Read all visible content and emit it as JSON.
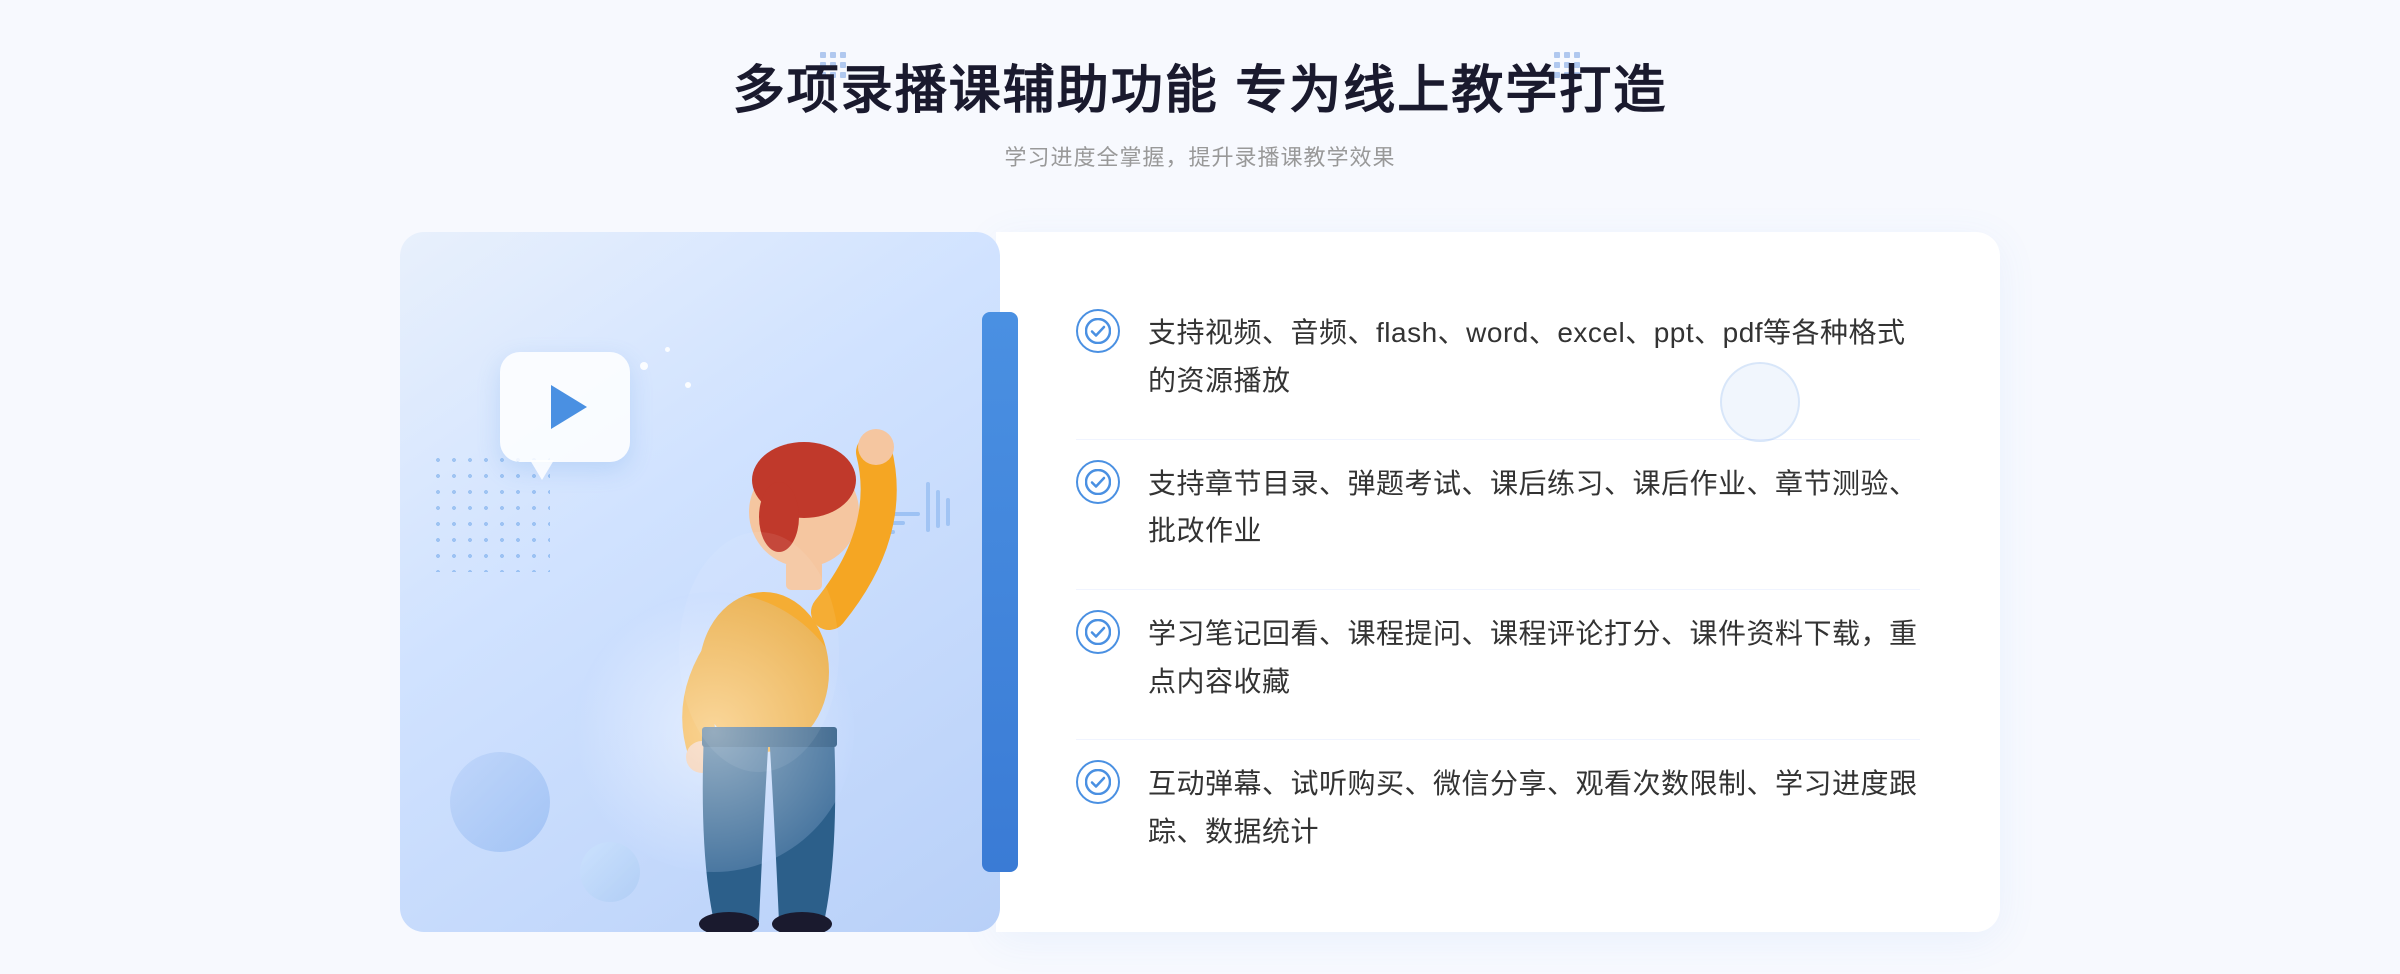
{
  "page": {
    "background_color": "#f7f9fe"
  },
  "header": {
    "main_title": "多项录播课辅助功能 专为线上教学打造",
    "sub_title": "学习进度全掌握，提升录播课教学效果"
  },
  "features": [
    {
      "id": 1,
      "text": "支持视频、音频、flash、word、excel、ppt、pdf等各种格式的资源播放"
    },
    {
      "id": 2,
      "text": "支持章节目录、弹题考试、课后练习、课后作业、章节测验、批改作业"
    },
    {
      "id": 3,
      "text": "学习笔记回看、课程提问、课程评论打分、课件资料下载，重点内容收藏"
    },
    {
      "id": 4,
      "text": "互动弹幕、试听购买、微信分享、观看次数限制、学习进度跟踪、数据统计"
    }
  ],
  "icons": {
    "check": "✓",
    "play": "▶",
    "chevron_left": "«"
  },
  "colors": {
    "primary": "#4a90e2",
    "text_dark": "#1a1a2e",
    "text_gray": "#999999",
    "text_body": "#333333",
    "bg_card": "#ffffff",
    "bg_illustration": "#d0e2ff"
  }
}
